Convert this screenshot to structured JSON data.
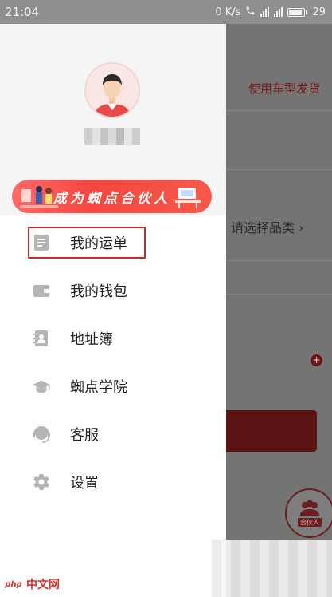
{
  "status_bar": {
    "time": "21:04",
    "network_speed": "0 K/s",
    "battery": "29"
  },
  "background_page": {
    "vehicle_link": "使用车型发货",
    "category_prompt": "请选择品类",
    "badge_label": "合伙人"
  },
  "drawer": {
    "username": "",
    "partner_banner": "成为蜘点合伙人",
    "menu": [
      {
        "label": "我的运单",
        "icon": "waybill-icon"
      },
      {
        "label": "我的钱包",
        "icon": "wallet-icon"
      },
      {
        "label": "地址簿",
        "icon": "address-book-icon"
      },
      {
        "label": "蜘点学院",
        "icon": "graduation-cap-icon"
      },
      {
        "label": "客服",
        "icon": "headset-icon"
      },
      {
        "label": "设置",
        "icon": "gear-icon"
      }
    ]
  },
  "watermark": {
    "logo": "php",
    "site": "中文网"
  },
  "colors": {
    "accent": "#c52b2b",
    "banner": "#f4473f",
    "icon_gray": "#b5b5b5"
  }
}
